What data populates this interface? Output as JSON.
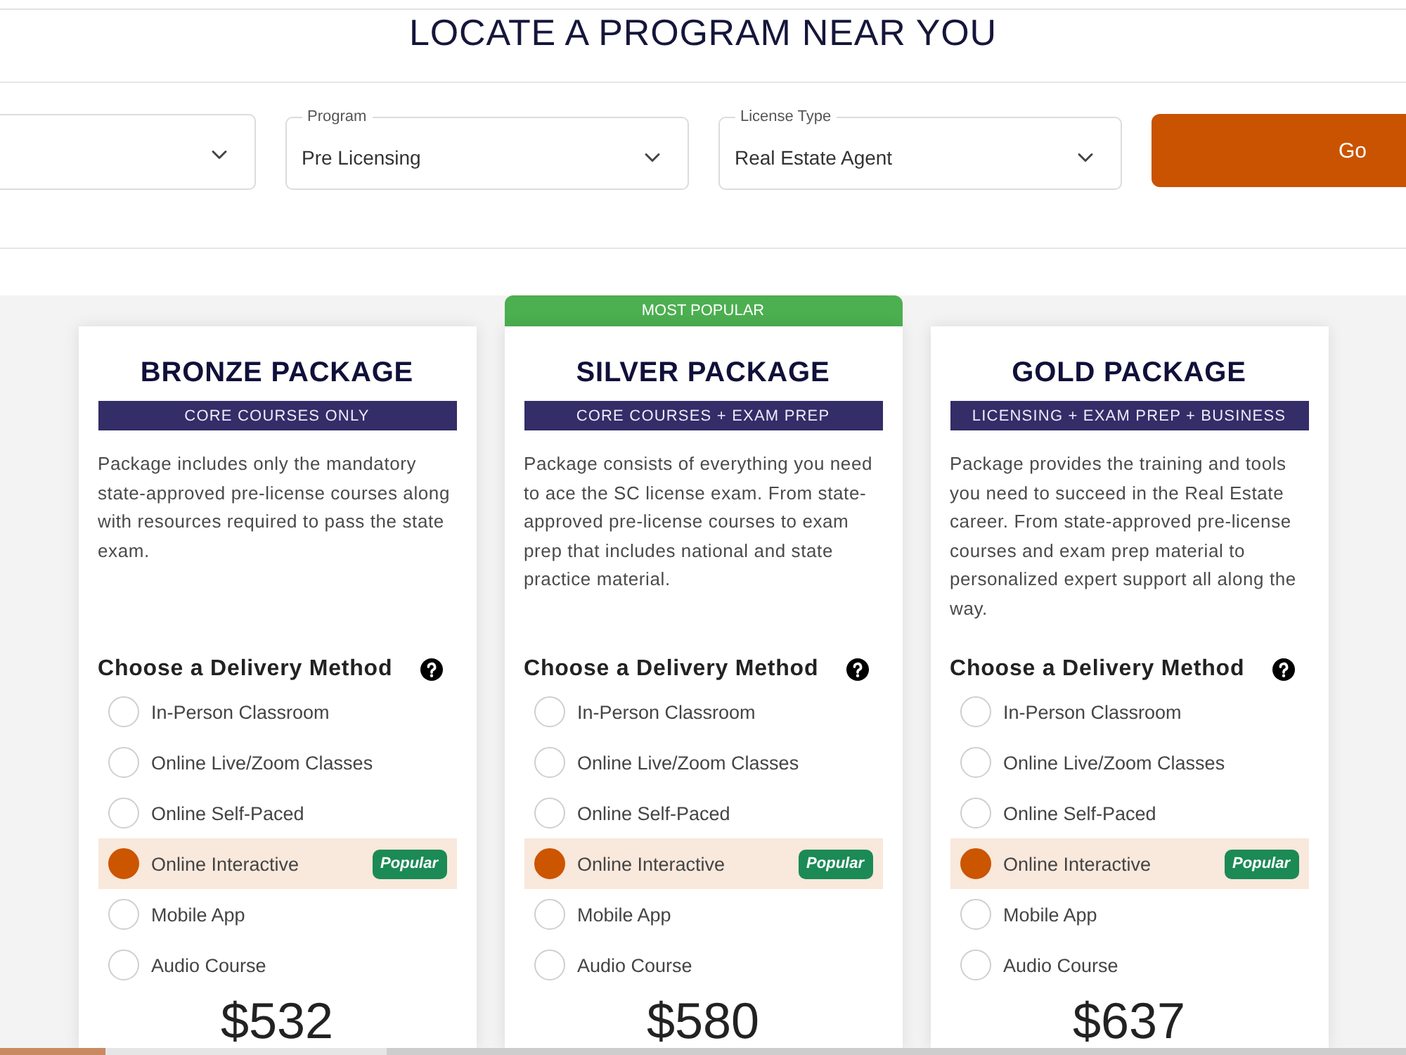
{
  "header": {
    "title": "LOCATE A PROGRAM NEAR YOU"
  },
  "filters": [
    {
      "kind": "select"
    },
    {
      "kind": "select",
      "label": "Program",
      "value": "Pre Licensing"
    },
    {
      "kind": "select",
      "label": "License Type",
      "value": "Real Estate Agent"
    },
    {
      "kind": "button",
      "label": "Go"
    }
  ],
  "packages": [
    {
      "title": "BRONZE PACKAGE",
      "subtitle": "CORE COURSES ONLY",
      "description": "Package includes only the mandatory state-approved pre-license courses along with resources required to pass the state exam.",
      "delivery_heading": "Choose a Delivery Method",
      "methods": [
        {
          "label": "In-Person Classroom",
          "selected": false
        },
        {
          "label": "Online Live/Zoom Classes",
          "selected": false
        },
        {
          "label": "Online Self-Paced",
          "selected": false
        },
        {
          "label": "Online Interactive",
          "selected": true,
          "badge": "Popular"
        },
        {
          "label": "Mobile App",
          "selected": false
        },
        {
          "label": "Audio Course",
          "selected": false
        }
      ],
      "price": "$532"
    },
    {
      "ribbon": "MOST POPULAR",
      "title": "SILVER PACKAGE",
      "subtitle": "CORE COURSES + EXAM PREP",
      "description": "Package consists of everything you need to ace the SC license exam. From state-approved pre-license courses to exam prep that includes national and state practice material.",
      "delivery_heading": "Choose a Delivery Method",
      "methods": [
        {
          "label": "In-Person Classroom",
          "selected": false
        },
        {
          "label": "Online Live/Zoom Classes",
          "selected": false
        },
        {
          "label": "Online Self-Paced",
          "selected": false
        },
        {
          "label": "Online Interactive",
          "selected": true,
          "badge": "Popular"
        },
        {
          "label": "Mobile App",
          "selected": false
        },
        {
          "label": "Audio Course",
          "selected": false
        }
      ],
      "price": "$580"
    },
    {
      "title": "GOLD PACKAGE",
      "subtitle": "LICENSING + EXAM PREP + BUSINESS",
      "description": "Package provides the training and tools you need to succeed in the Real Estate career. From state-approved pre-license courses and exam prep material to personalized expert support all along the way.",
      "delivery_heading": "Choose a Delivery Method",
      "methods": [
        {
          "label": "In-Person Classroom",
          "selected": false
        },
        {
          "label": "Online Live/Zoom Classes",
          "selected": false
        },
        {
          "label": "Online Self-Paced",
          "selected": false
        },
        {
          "label": "Online Interactive",
          "selected": true,
          "badge": "Popular"
        },
        {
          "label": "Mobile App",
          "selected": false
        },
        {
          "label": "Audio Course",
          "selected": false
        }
      ],
      "price": "$637"
    }
  ]
}
